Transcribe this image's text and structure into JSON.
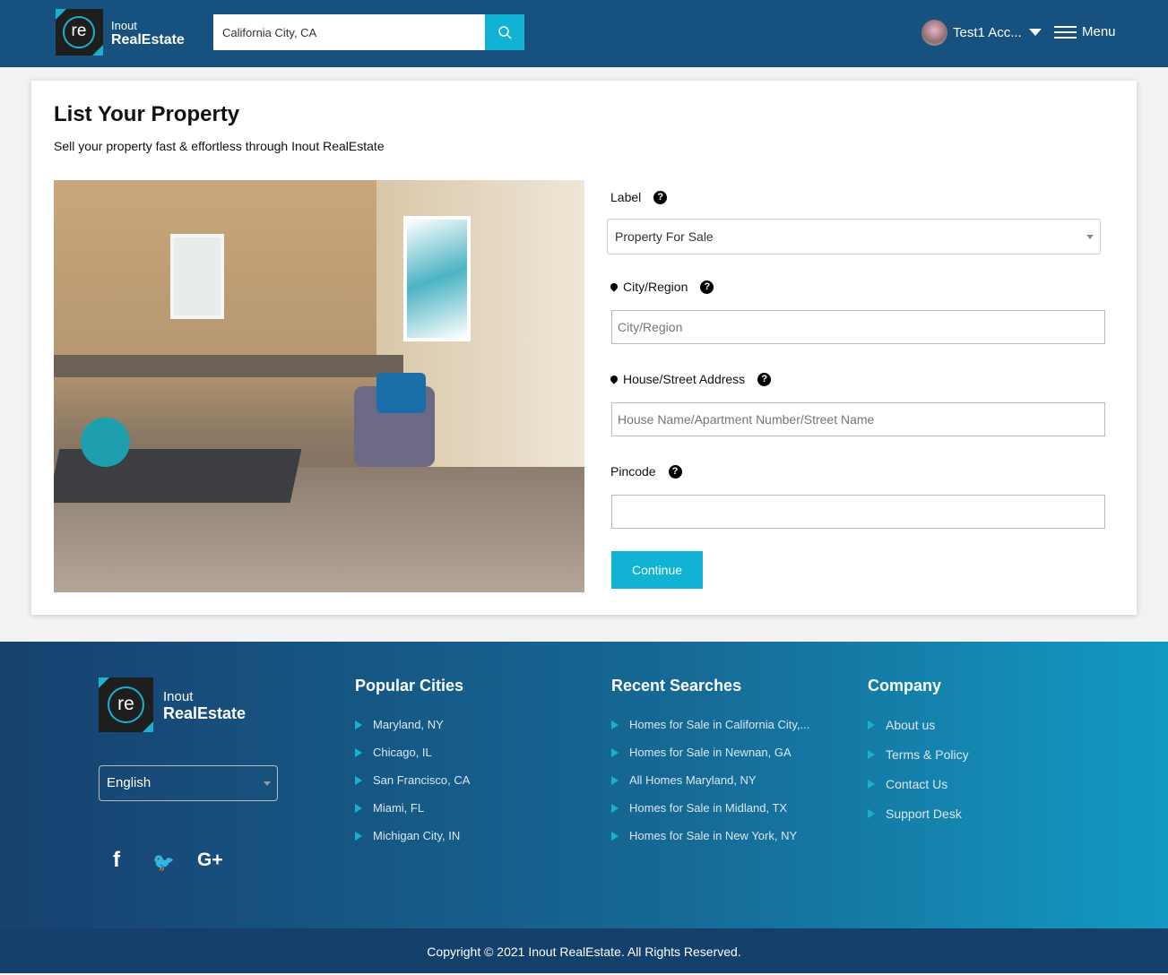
{
  "header": {
    "brand_top": "Inout",
    "brand_bottom": "RealEstate",
    "logo_text": "re",
    "search_value": "California City, CA",
    "user_name": "Test1 Acc...",
    "menu_label": "Menu"
  },
  "page": {
    "title": "List Your Property",
    "subtitle": "Sell your property fast & effortless through Inout RealEstate"
  },
  "form": {
    "label_label": "Label",
    "label_value": "Property For Sale",
    "city_label": "City/Region",
    "city_placeholder": "City/Region",
    "address_label": "House/Street Address",
    "address_placeholder": "House Name/Apartment Number/Street Name",
    "pincode_label": "Pincode",
    "pincode_value": "",
    "continue_label": "Continue",
    "help": "?"
  },
  "footer": {
    "language": "English",
    "popular_title": "Popular Cities",
    "popular": [
      "Maryland, NY",
      "Chicago, IL",
      "San Francisco, CA",
      "Miami, FL",
      "Michigan City, IN"
    ],
    "recent_title": "Recent Searches",
    "recent": [
      "Homes for Sale in California City,...",
      "Homes for Sale in Newnan, GA",
      "All Homes Maryland, NY",
      "Homes for Sale in Midland, TX",
      "Homes for Sale in New York, NY"
    ],
    "company_title": "Company",
    "company": [
      "About us",
      "Terms & Policy",
      "Contact Us",
      "Support Desk"
    ],
    "social": {
      "facebook": "f",
      "twitter": "🐦",
      "google": "G+"
    },
    "copyright": "Copyright © 2021 Inout RealEstate. All Rights Reserved."
  },
  "colors": {
    "header": "#16517f",
    "accent": "#11b3d4"
  }
}
